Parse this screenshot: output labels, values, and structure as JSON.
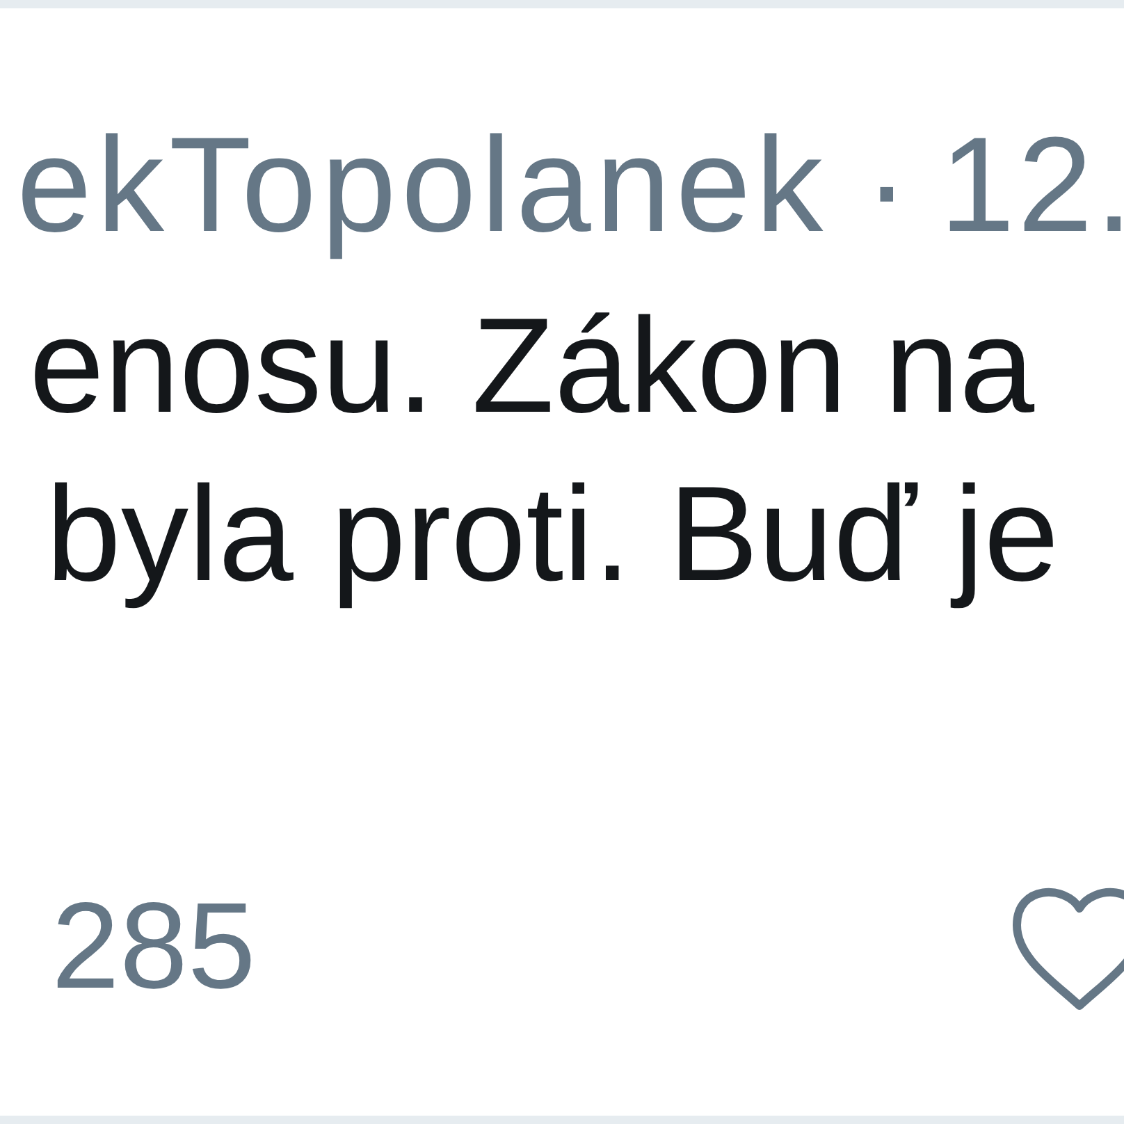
{
  "tweet": {
    "author_handle": "ekTopolanek",
    "separator": "·",
    "date": "12.",
    "text_lines": [
      "enosu. Zákon na",
      "byla proti. Buď je"
    ],
    "actions": [
      {
        "kind": "count",
        "count": "285"
      },
      {
        "kind": "like",
        "liked": false
      }
    ]
  }
}
